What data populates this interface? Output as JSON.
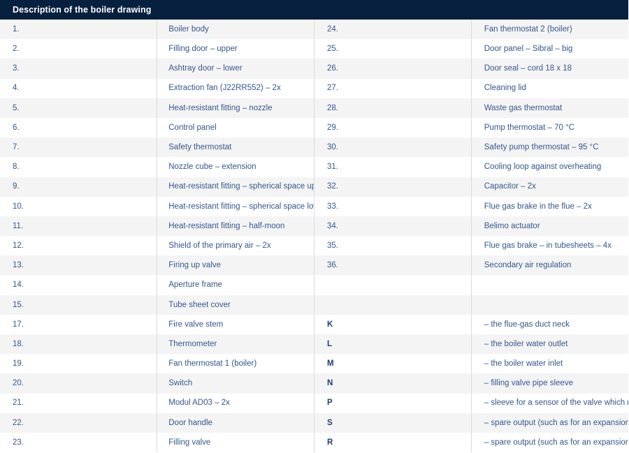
{
  "header": {
    "title": "Description of the boiler drawing"
  },
  "colors": {
    "header_bg": "#07203f",
    "header_text": "#ffffff",
    "row_stripe": "#f4f4f5",
    "row_plain": "#ffffff",
    "text": "#35568c",
    "key_text": "#1f3f73",
    "divider": "#d9dade"
  },
  "rows": [
    {
      "num": "1.",
      "desc": "Boiler body",
      "num2": "24.",
      "desc2": "Fan thermostat 2 (boiler)",
      "key2_bold": false
    },
    {
      "num": "2.",
      "desc": "Filling door – upper",
      "num2": "25.",
      "desc2": "Door panel – Sibral – big",
      "key2_bold": false
    },
    {
      "num": "3.",
      "desc": "Ashtray door – lower",
      "num2": "26.",
      "desc2": "Door seal – cord 18 x 18",
      "key2_bold": false
    },
    {
      "num": "4.",
      "desc": "Extraction fan (J22RR552) – 2x",
      "num2": "27.",
      "desc2": "Cleaning lid",
      "key2_bold": false
    },
    {
      "num": "5.",
      "desc": "Heat-resistant fitting – nozzle",
      "num2": "28.",
      "desc2": "Waste gas thermostat",
      "key2_bold": false
    },
    {
      "num": "6.",
      "desc": "Control panel",
      "num2": "29.",
      "desc2": "Pump thermostat – 70 °C",
      "key2_bold": false
    },
    {
      "num": "7.",
      "desc": "Safety thermostat",
      "num2": "30.",
      "desc2": "Safety pump thermostat – 95 °C",
      "key2_bold": false
    },
    {
      "num": "8.",
      "desc": "Nozzle cube – extension",
      "num2": "31.",
      "desc2": "Cooling loop against overheating",
      "key2_bold": false
    },
    {
      "num": "9.",
      "desc": "Heat-resistant fitting – spherical space upper",
      "num2": "32.",
      "desc2": "Capacitor – 2x",
      "key2_bold": false
    },
    {
      "num": "10.",
      "desc": "Heat-resistant fitting – spherical space lower",
      "num2": "33.",
      "desc2": "Flue gas brake in the flue – 2x",
      "key2_bold": false
    },
    {
      "num": "11.",
      "desc": "Heat-resistant fitting – half-moon",
      "num2": "34.",
      "desc2": "Belimo actuator",
      "key2_bold": false
    },
    {
      "num": "12.",
      "desc": "Shield of the primary air – 2x",
      "num2": "35.",
      "desc2": "Flue gas brake – in tubesheets – 4x",
      "key2_bold": false
    },
    {
      "num": "13.",
      "desc": "Firing up valve",
      "num2": "36.",
      "desc2": "Secondary air regulation",
      "key2_bold": false
    },
    {
      "num": "14.",
      "desc": "Aperture frame",
      "num2": "",
      "desc2": "",
      "key2_bold": false
    },
    {
      "num": "15.",
      "desc": "Tube sheet cover",
      "num2": "",
      "desc2": "",
      "key2_bold": false
    },
    {
      "num": "17.",
      "desc": "Fire valve stem",
      "num2": "K",
      "desc2": "– the flue-gas duct neck",
      "key2_bold": true
    },
    {
      "num": "18.",
      "desc": "Thermometer",
      "num2": "L",
      "desc2": "– the boiler water outlet",
      "key2_bold": true
    },
    {
      "num": "19.",
      "desc": "Fan thermostat 1 (boiler)",
      "num2": "M",
      "desc2": "– the boiler water inlet",
      "key2_bold": true
    },
    {
      "num": "20.",
      "desc": "Switch",
      "num2": "N",
      "desc2": "– filling valve pipe sleeve",
      "key2_bold": true
    },
    {
      "num": "21.",
      "desc": "Modul AD03 – 2x",
      "num2": "P",
      "desc2": "– sleeve for a sensor of the valve which regulates the cooling loop",
      "key2_bold": true
    },
    {
      "num": "22.",
      "desc": "Door handle",
      "num2": "S",
      "desc2": "– spare output (such as for an expansion tank or a water heater)",
      "key2_bold": true
    },
    {
      "num": "23.",
      "desc": "Filling valve",
      "num2": "R",
      "desc2": "– spare output (such as for an expansion tank or a water heater)",
      "key2_bold": true
    }
  ]
}
